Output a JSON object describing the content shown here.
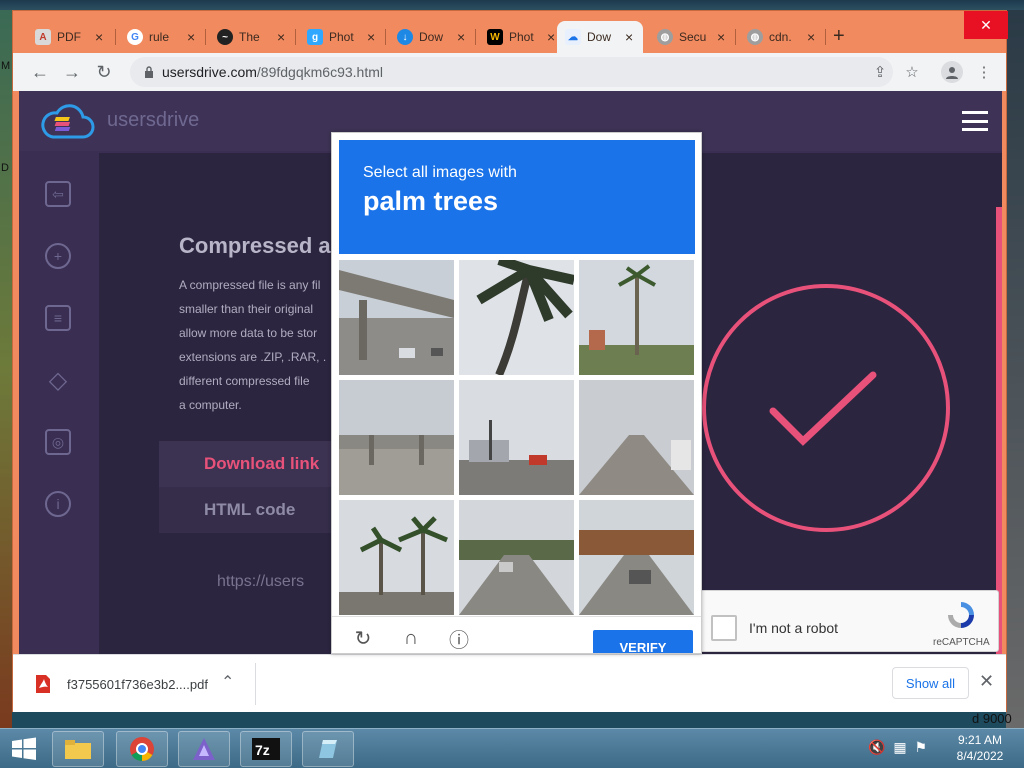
{
  "desktop": {
    "frag_m": "M",
    "frag_d": "D",
    "frag_right": "d 9000"
  },
  "tabs": [
    {
      "label": "PDF",
      "fav_color": "#d9d9d9",
      "fav_glyph": "A"
    },
    {
      "label": "rule",
      "fav_color": "#ffffff",
      "fav_glyph": "G"
    },
    {
      "label": "The",
      "fav_color": "#222222",
      "fav_glyph": "~"
    },
    {
      "label": "Phot",
      "fav_color": "#31a8ff",
      "fav_glyph": "g"
    },
    {
      "label": "Dow",
      "fav_color": "#1e88e5",
      "fav_glyph": "↓"
    },
    {
      "label": "Phot",
      "fav_color": "#000000",
      "fav_glyph": "W"
    },
    {
      "label": "Dow",
      "fav_color": "#e8f0fe",
      "fav_glyph": "☁"
    },
    {
      "label": "Secu",
      "fav_color": "#9e9e9e",
      "fav_glyph": "◍"
    },
    {
      "label": "cdn.",
      "fav_color": "#9e9e9e",
      "fav_glyph": "◍"
    }
  ],
  "toolbar": {
    "url_domain": "usersdrive.com",
    "url_path": "/89fdgqkm6c93.html"
  },
  "site": {
    "brand": "usersdrive",
    "title": "Compressed a",
    "paragraph": [
      "A compressed file is any fil",
      "smaller than their original",
      "allow more data to be stor",
      "extensions are .ZIP, .RAR, .",
      "different compressed file",
      "a computer."
    ],
    "download_link": "Download link",
    "html_code": "HTML code",
    "link_preview": "https://users"
  },
  "captcha": {
    "instruction": "Select all images with",
    "target": "palm trees",
    "verify": "VERIFY"
  },
  "recaptcha": {
    "label": "I'm not a robot",
    "brand": "reCAPTCHA"
  },
  "download_bar": {
    "filename": "f3755601f736e3b2....pdf",
    "show_all": "Show all"
  },
  "taskbar": {
    "time": "9:21 AM",
    "date": "8/4/2022"
  },
  "colors": {
    "accent_pink": "#e8527a",
    "captcha_blue": "#1a73e8",
    "browser_frame": "#f28a5f"
  }
}
